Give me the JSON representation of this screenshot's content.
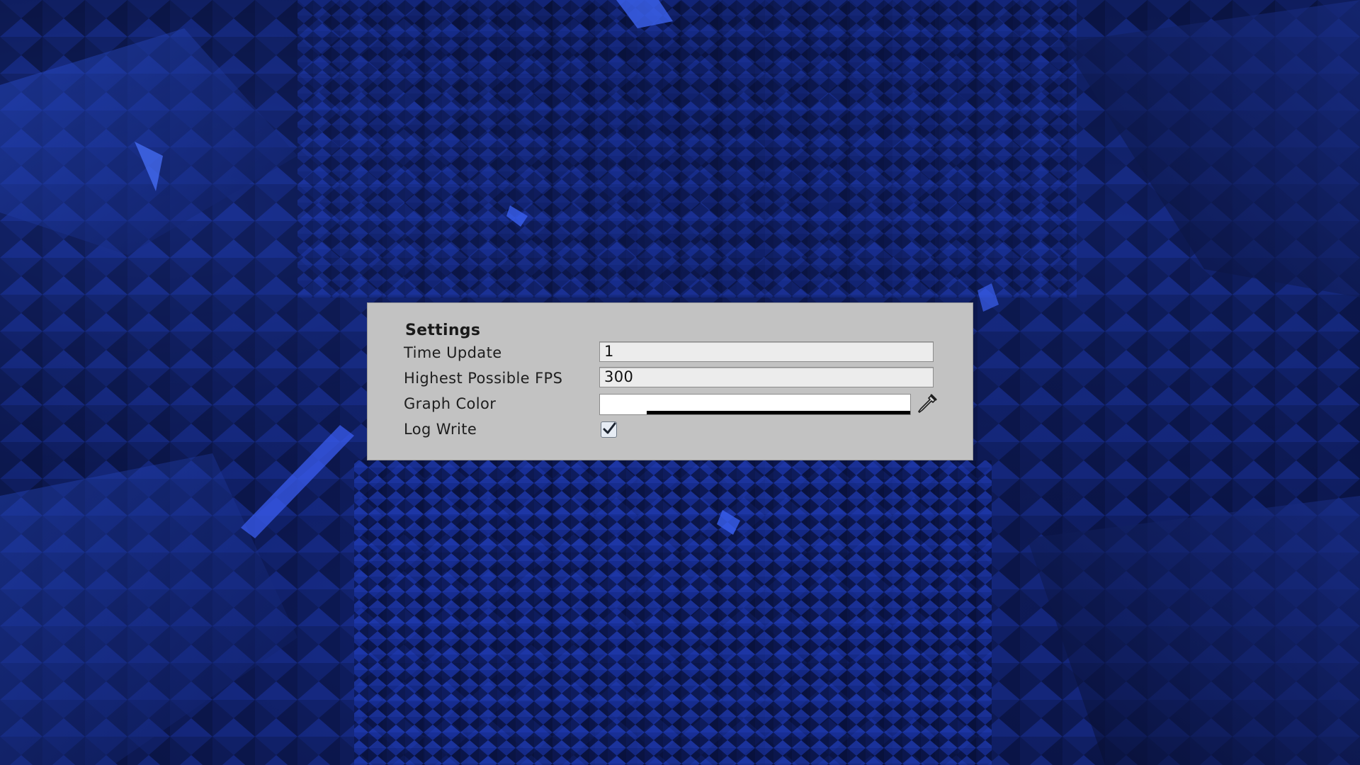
{
  "background": {
    "scene": "dark-blue-fractal-landscape",
    "base_color": "#081035",
    "accent_color": "#2a4cd6"
  },
  "panel": {
    "title": "Settings",
    "background_color": "#c2c2c2",
    "rows": [
      {
        "label": "Time Update",
        "type": "text-field",
        "value": "1"
      },
      {
        "label": "Highest Possible FPS",
        "type": "text-field",
        "value": "300"
      },
      {
        "label": "Graph Color",
        "type": "color-field",
        "value": "#ffffff",
        "alpha_bar_color": "#000000",
        "icon": "eyedropper-icon"
      },
      {
        "label": "Log Write",
        "type": "checkbox",
        "checked": true,
        "icon": "checkmark-icon"
      }
    ]
  }
}
